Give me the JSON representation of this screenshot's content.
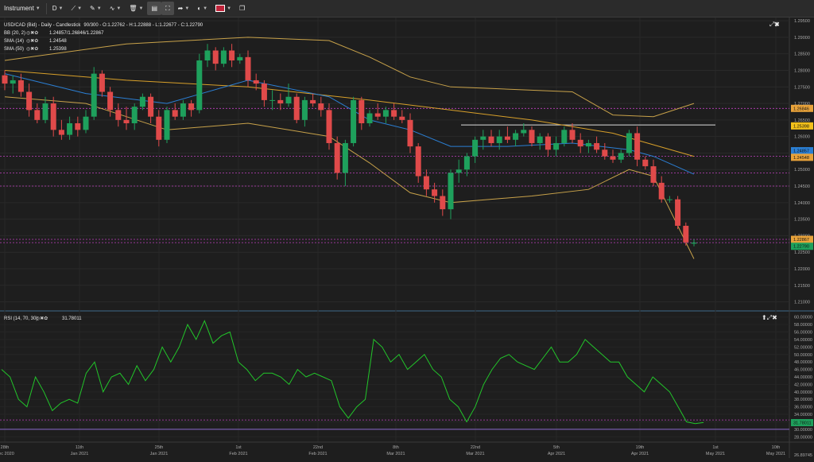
{
  "toolbar": {
    "instrument_label": "Instrument",
    "timeframe_label": "D",
    "items": [
      "line-tool-icon",
      "pen-tool-icon",
      "curve-tool-icon",
      "delete-icon",
      "layout-icon",
      "fullscreen-icon",
      "share-icon",
      "theme-icon",
      "flag-uk-icon",
      "popout-icon"
    ]
  },
  "legend": {
    "main": "USD/CAD (Bid) - Daily - Candlestick",
    "main_values": "90/300 - O:1.22762 - H:1.22888 - L:1.22677 - C:1.22790",
    "bb_label": "BB (20, 2)",
    "bb_values": "1.24857/1.26846/1.22867",
    "sma14_label": "SMA (14)",
    "sma14_value": "1.24548",
    "sma50_label": "SMA (50)",
    "sma50_value": "1.25398"
  },
  "rsi_legend": {
    "label": "RSI (14, 70, 30)",
    "value": "31.78011"
  },
  "price_axis": {
    "ticks": [
      "1.29500",
      "1.29000",
      "1.28500",
      "1.28000",
      "1.27500",
      "1.27000",
      "1.26500",
      "1.26000",
      "1.25500",
      "1.25000",
      "1.24500",
      "1.24000",
      "1.23500",
      "1.23000",
      "1.22500",
      "1.22000",
      "1.21500",
      "1.21000"
    ],
    "badges": [
      {
        "text": "1.26846",
        "color": "#e8a23a"
      },
      {
        "text": "1.25398",
        "color": "#f2c01a"
      },
      {
        "text": "1.24857",
        "color": "#2b7fd4"
      },
      {
        "text": "1.24548",
        "color": "#e8a23a"
      },
      {
        "text": "1.22867",
        "color": "#e8a23a"
      },
      {
        "text": "1.22790",
        "color": "#1ea05c"
      }
    ]
  },
  "rsi_axis": {
    "ticks": [
      "60.00000",
      "58.00000",
      "56.00000",
      "54.00000",
      "52.00000",
      "50.00000",
      "48.00000",
      "46.00000",
      "44.00000",
      "42.00000",
      "40.00000",
      "38.00000",
      "36.00000",
      "34.00000",
      "32.00000",
      "30.00000",
      "28.00000"
    ],
    "badge": {
      "text": "31.78011",
      "color": "#1ea05c"
    },
    "bottom_label": "26.89745"
  },
  "date_axis": [
    {
      "d": "28th",
      "m": "Dec 2020"
    },
    {
      "d": "11th",
      "m": "Jan 2021"
    },
    {
      "d": "25th",
      "m": "Jan 2021"
    },
    {
      "d": "1st",
      "m": "Feb 2021"
    },
    {
      "d": "22nd",
      "m": "Feb 2021"
    },
    {
      "d": "8th",
      "m": "Mar 2021"
    },
    {
      "d": "22nd",
      "m": "Mar 2021"
    },
    {
      "d": "5th",
      "m": "Apr 2021"
    },
    {
      "d": "19th",
      "m": "Apr 2021"
    },
    {
      "d": "1st",
      "m": "May 2021"
    },
    {
      "d": "10th",
      "m": "May 2021"
    }
  ],
  "colors": {
    "up": "#1ea05c",
    "down": "#e04a4a",
    "bb": "#c8a24a",
    "sma14": "#2b7fd4",
    "sma50": "#d8a02a",
    "rsi": "#22c52a",
    "dashed": "#c040c0"
  },
  "chart_data": {
    "type": "candlestick",
    "candles": [
      [
        1.2785,
        1.28,
        1.274,
        1.276
      ],
      [
        1.276,
        1.2785,
        1.273,
        1.277
      ],
      [
        1.277,
        1.279,
        1.272,
        1.2735
      ],
      [
        1.2735,
        1.276,
        1.266,
        1.268
      ],
      [
        1.268,
        1.27,
        1.264,
        1.265
      ],
      [
        1.265,
        1.272,
        1.264,
        1.27
      ],
      [
        1.27,
        1.272,
        1.26,
        1.262
      ],
      [
        1.262,
        1.265,
        1.259,
        1.2605
      ],
      [
        1.2605,
        1.266,
        1.259,
        1.264
      ],
      [
        1.264,
        1.266,
        1.26,
        1.262
      ],
      [
        1.262,
        1.268,
        1.261,
        1.266
      ],
      [
        1.266,
        1.281,
        1.265,
        1.279
      ],
      [
        1.279,
        1.28,
        1.272,
        1.2735
      ],
      [
        1.2735,
        1.275,
        1.266,
        1.268
      ],
      [
        1.268,
        1.27,
        1.263,
        1.265
      ],
      [
        1.265,
        1.269,
        1.262,
        1.264
      ],
      [
        1.264,
        1.27,
        1.262,
        1.269
      ],
      [
        1.269,
        1.273,
        1.268,
        1.272
      ],
      [
        1.272,
        1.273,
        1.264,
        1.266
      ],
      [
        1.266,
        1.268,
        1.257,
        1.259
      ],
      [
        1.259,
        1.269,
        1.258,
        1.268
      ],
      [
        1.268,
        1.27,
        1.265,
        1.266
      ],
      [
        1.266,
        1.271,
        1.265,
        1.27
      ],
      [
        1.27,
        1.271,
        1.266,
        1.268
      ],
      [
        1.268,
        1.285,
        1.267,
        1.283
      ],
      [
        1.283,
        1.288,
        1.281,
        1.286
      ],
      [
        1.286,
        1.287,
        1.28,
        1.282
      ],
      [
        1.282,
        1.287,
        1.281,
        1.286
      ],
      [
        1.286,
        1.288,
        1.281,
        1.283
      ],
      [
        1.283,
        1.285,
        1.282,
        1.284
      ],
      [
        1.284,
        1.286,
        1.275,
        1.277
      ],
      [
        1.277,
        1.279,
        1.274,
        1.276
      ],
      [
        1.276,
        1.277,
        1.269,
        1.271
      ],
      [
        1.271,
        1.274,
        1.268,
        1.271
      ],
      [
        1.271,
        1.273,
        1.268,
        1.27
      ],
      [
        1.27,
        1.276,
        1.269,
        1.272
      ],
      [
        1.272,
        1.273,
        1.264,
        1.265
      ],
      [
        1.265,
        1.272,
        1.263,
        1.271
      ],
      [
        1.271,
        1.273,
        1.269,
        1.27
      ],
      [
        1.27,
        1.272,
        1.266,
        1.268
      ],
      [
        1.268,
        1.27,
        1.256,
        1.258
      ],
      [
        1.258,
        1.26,
        1.247,
        1.249
      ],
      [
        1.249,
        1.259,
        1.245,
        1.258
      ],
      [
        1.258,
        1.272,
        1.257,
        1.271
      ],
      [
        1.271,
        1.272,
        1.262,
        1.264
      ],
      [
        1.264,
        1.268,
        1.263,
        1.267
      ],
      [
        1.267,
        1.27,
        1.265,
        1.266
      ],
      [
        1.266,
        1.269,
        1.264,
        1.268
      ],
      [
        1.268,
        1.27,
        1.265,
        1.266
      ],
      [
        1.266,
        1.268,
        1.264,
        1.265
      ],
      [
        1.265,
        1.267,
        1.255,
        1.257
      ],
      [
        1.257,
        1.258,
        1.246,
        1.248
      ],
      [
        1.248,
        1.25,
        1.242,
        1.244
      ],
      [
        1.244,
        1.246,
        1.24,
        1.242
      ],
      [
        1.242,
        1.244,
        1.236,
        1.238
      ],
      [
        1.238,
        1.25,
        1.235,
        1.249
      ],
      [
        1.249,
        1.253,
        1.246,
        1.25
      ],
      [
        1.25,
        1.255,
        1.248,
        1.254
      ],
      [
        1.254,
        1.26,
        1.252,
        1.259
      ],
      [
        1.259,
        1.262,
        1.256,
        1.26
      ],
      [
        1.26,
        1.262,
        1.257,
        1.258
      ],
      [
        1.258,
        1.262,
        1.256,
        1.26
      ],
      [
        1.26,
        1.263,
        1.258,
        1.259
      ],
      [
        1.259,
        1.262,
        1.257,
        1.261
      ],
      [
        1.261,
        1.264,
        1.26,
        1.262
      ],
      [
        1.262,
        1.263,
        1.257,
        1.258
      ],
      [
        1.258,
        1.261,
        1.256,
        1.26
      ],
      [
        1.26,
        1.261,
        1.254,
        1.256
      ],
      [
        1.256,
        1.26,
        1.254,
        1.258
      ],
      [
        1.258,
        1.263,
        1.257,
        1.262
      ],
      [
        1.262,
        1.264,
        1.258,
        1.259
      ],
      [
        1.259,
        1.261,
        1.255,
        1.257
      ],
      [
        1.257,
        1.259,
        1.255,
        1.258
      ],
      [
        1.258,
        1.26,
        1.255,
        1.256
      ],
      [
        1.256,
        1.258,
        1.253,
        1.254
      ],
      [
        1.254,
        1.256,
        1.252,
        1.253
      ],
      [
        1.253,
        1.256,
        1.252,
        1.255
      ],
      [
        1.255,
        1.262,
        1.254,
        1.261
      ],
      [
        1.261,
        1.263,
        1.251,
        1.253
      ],
      [
        1.253,
        1.254,
        1.25,
        1.251
      ],
      [
        1.251,
        1.253,
        1.245,
        1.246
      ],
      [
        1.246,
        1.248,
        1.24,
        1.241
      ],
      [
        1.241,
        1.242,
        1.24,
        1.241
      ],
      [
        1.241,
        1.242,
        1.232,
        1.233
      ],
      [
        1.233,
        1.234,
        1.227,
        1.228
      ],
      [
        1.2276,
        1.2289,
        1.2268,
        1.2279
      ]
    ],
    "bb_upper": [
      [
        0,
        1.283
      ],
      [
        15,
        1.288
      ],
      [
        30,
        1.29
      ],
      [
        40,
        1.289
      ],
      [
        45,
        1.284
      ],
      [
        50,
        1.278
      ],
      [
        55,
        1.275
      ],
      [
        60,
        1.2745
      ],
      [
        70,
        1.2735
      ],
      [
        75,
        1.2665
      ],
      [
        80,
        1.266
      ],
      [
        85,
        1.27
      ]
    ],
    "bb_lower": [
      [
        0,
        1.272
      ],
      [
        10,
        1.27
      ],
      [
        20,
        1.262
      ],
      [
        30,
        1.264
      ],
      [
        40,
        1.26
      ],
      [
        45,
        1.252
      ],
      [
        50,
        1.243
      ],
      [
        55,
        1.24
      ],
      [
        65,
        1.242
      ],
      [
        72,
        1.244
      ],
      [
        77,
        1.25
      ],
      [
        80,
        1.248
      ],
      [
        85,
        1.223
      ]
    ],
    "sma14": [
      [
        0,
        1.279
      ],
      [
        10,
        1.273
      ],
      [
        20,
        1.27
      ],
      [
        30,
        1.277
      ],
      [
        40,
        1.272
      ],
      [
        45,
        1.265
      ],
      [
        50,
        1.262
      ],
      [
        55,
        1.257
      ],
      [
        62,
        1.257
      ],
      [
        70,
        1.258
      ],
      [
        77,
        1.256
      ],
      [
        80,
        1.254
      ],
      [
        85,
        1.2486
      ]
    ],
    "sma50": [
      [
        0,
        1.28
      ],
      [
        15,
        1.277
      ],
      [
        30,
        1.275
      ],
      [
        45,
        1.271
      ],
      [
        55,
        1.268
      ],
      [
        65,
        1.265
      ],
      [
        75,
        1.261
      ],
      [
        85,
        1.254
      ]
    ],
    "rsi": [
      46,
      44,
      38,
      36,
      44,
      40,
      35,
      37,
      38,
      37,
      45,
      48,
      40,
      44,
      45,
      42,
      47,
      43,
      46,
      52,
      48,
      52,
      58,
      54,
      59,
      53,
      55,
      56,
      48,
      46,
      43,
      45,
      45,
      44,
      42,
      46,
      44,
      45,
      44,
      43,
      36,
      33,
      36,
      38,
      54,
      52,
      48,
      50,
      46,
      48,
      50,
      46,
      44,
      38,
      36,
      32,
      36,
      42,
      46,
      49,
      50,
      48,
      47,
      46,
      49,
      52,
      48,
      48,
      50,
      54,
      52,
      50,
      48,
      48,
      44,
      42,
      40,
      44,
      42,
      40,
      36,
      32,
      31.5,
      31.8
    ]
  }
}
